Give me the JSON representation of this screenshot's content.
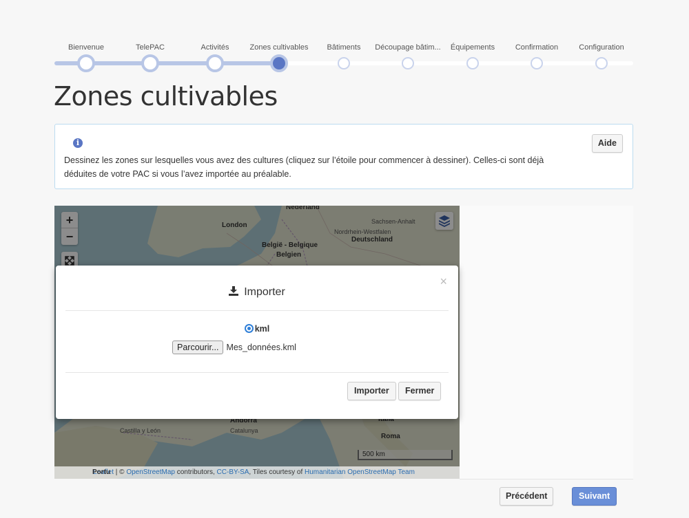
{
  "stepper": {
    "steps": [
      {
        "label": "Bienvenue",
        "state": "done"
      },
      {
        "label": "TelePAC",
        "state": "done"
      },
      {
        "label": "Activités",
        "state": "done"
      },
      {
        "label": "Zones cultivables",
        "state": "current"
      },
      {
        "label": "Bâtiments",
        "state": "todo"
      },
      {
        "label": "Découpage bâtim...",
        "state": "todo"
      },
      {
        "label": "Équipements",
        "state": "todo"
      },
      {
        "label": "Confirmation",
        "state": "todo"
      },
      {
        "label": "Configuration",
        "state": "todo"
      }
    ]
  },
  "page": {
    "title": "Zones cultivables"
  },
  "info": {
    "icon": "info-icon",
    "line1": "Dessinez les zones sur lesquelles vous avez des cultures (cliquez sur l’étoile pour commencer à dessiner). Celles-ci sont déjà",
    "line2": "déduites de votre PAC si vous l’avez importée au préalable.",
    "help_label": "Aide"
  },
  "map": {
    "zoom_in": "+",
    "zoom_out": "−",
    "labels": {
      "nederland": "Nederland",
      "london": "London",
      "belgie": "België - Belgique",
      "belgien": "Belgien",
      "deutschland": "Deutschland",
      "andorra": "Andorra",
      "italia": "Italia",
      "roma": "Roma",
      "castilla": "Castilla y León",
      "catalunya": "Catalunya",
      "nordrhein": "Nordrhein-Westfalen",
      "sachsen": "Sachsen-Anhalt"
    },
    "scale": "500 km",
    "attribution": {
      "prefix": "Portu",
      "leaflet": "Leaflet",
      "sep1": " | © ",
      "osm": "OpenStreetMap",
      "contributors": " contributors, ",
      "license": "CC-BY-SA",
      "tiles": ", Tiles courtesy of ",
      "hot": "Humanitarian OpenStreetMap Team"
    }
  },
  "modal": {
    "title": "Importer",
    "close": "×",
    "format_option": "kml",
    "browse_label": "Parcourir...",
    "file_name": "Mes_données.kml",
    "import_label": "Importer",
    "close_label": "Fermer"
  },
  "footer": {
    "prev_label": "Précédent",
    "next_label": "Suivant"
  },
  "colors": {
    "accent": "#5a76c4",
    "next_button": "#6a8fd8",
    "radio": "#2f7fd8"
  }
}
